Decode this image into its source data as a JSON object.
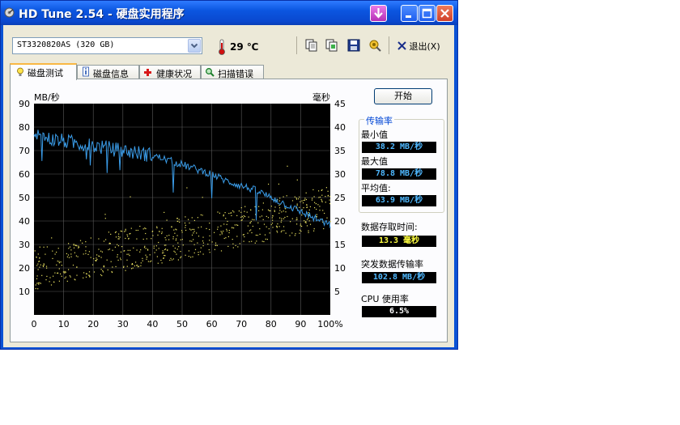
{
  "window": {
    "title": "HD Tune 2.54 - 硬盘实用程序"
  },
  "toolbar": {
    "drive": "ST3320820AS (320 GB)",
    "temperature": "29 ℃",
    "exit_label": "退出(X)"
  },
  "tabs": [
    {
      "label": "磁盘测试",
      "active": true
    },
    {
      "label": "磁盘信息",
      "active": false
    },
    {
      "label": "健康状况",
      "active": false
    },
    {
      "label": "扫描错误",
      "active": false
    }
  ],
  "start_button": "开始",
  "stats": {
    "group_title": "传输率",
    "min_label": "最小值",
    "min_value": "38.2 MB/秒",
    "max_label": "最大值",
    "max_value": "78.8 MB/秒",
    "avg_label": "平均值:",
    "avg_value": "63.9 MB/秒",
    "access_label": "数据存取时间:",
    "access_value": "13.3 毫秒",
    "burst_label": "突发数据传输率",
    "burst_value": "102.8 MB/秒",
    "cpu_label": "CPU 使用率",
    "cpu_value": "6.5%"
  },
  "colors": {
    "value_text": "#4fb8ff",
    "access_text": "#ffff40",
    "cpu_text": "#ffffff",
    "line": "#3a9ce8",
    "scatter": "#e8e060"
  },
  "chart_data": {
    "type": "line",
    "ylabel_left": "MB/秒",
    "ylabel_right": "毫秒",
    "ylim_left": [
      0,
      90
    ],
    "ylim_right": [
      0,
      45
    ],
    "yticks_left": [
      "90",
      "80",
      "70",
      "60",
      "50",
      "40",
      "30",
      "20",
      "10"
    ],
    "yticks_right": [
      "45",
      "40",
      "35",
      "30",
      "25",
      "20",
      "15",
      "10",
      "5"
    ],
    "xticks": [
      "0",
      "10",
      "20",
      "30",
      "40",
      "50",
      "60",
      "70",
      "80",
      "90",
      "100%"
    ],
    "grid": true,
    "series": [
      {
        "x": [
          0,
          5,
          10,
          15,
          20,
          25,
          30,
          35,
          40,
          45,
          50,
          55,
          60,
          65,
          70,
          75,
          80,
          85,
          90,
          95,
          100
        ],
        "values": [
          77,
          75,
          74,
          73,
          72,
          71,
          70,
          69,
          68,
          66,
          64,
          62,
          60,
          57,
          55,
          53,
          50,
          47,
          44,
          41,
          38
        ]
      }
    ],
    "access_scatter": {
      "x_range": [
        0,
        100
      ],
      "y_trend_ms": [
        [
          0,
          10
        ],
        [
          100,
          23
        ]
      ]
    }
  }
}
